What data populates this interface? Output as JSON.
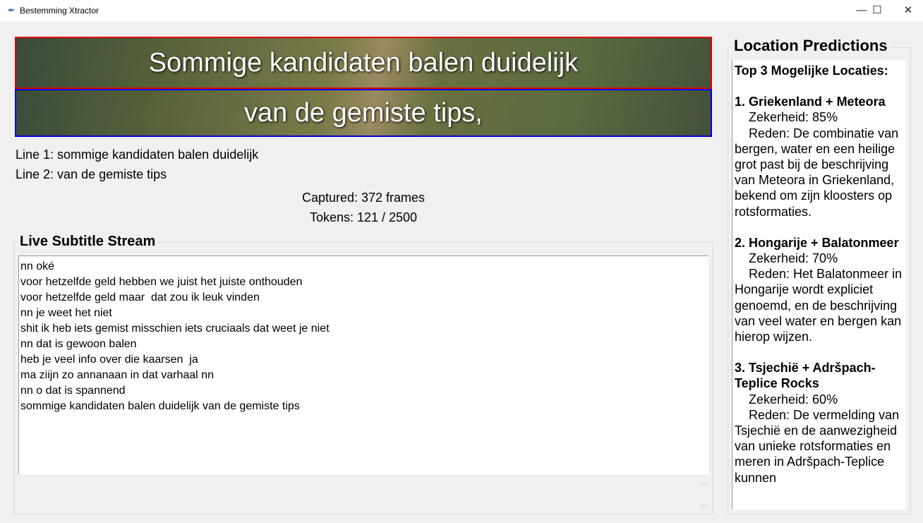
{
  "window": {
    "title": "Bestemming Xtractor",
    "minimize": "—",
    "maximize": "☐",
    "close": "✕"
  },
  "video": {
    "line1_overlay": "Sommige kandidaten balen duidelijk",
    "line2_overlay": "van de gemiste tips,"
  },
  "ocr": {
    "line1": "Line 1: sommige kandidaten balen duidelijk",
    "line2": "Line 2: van de gemiste tips"
  },
  "stats": {
    "captured": "Captured: 372 frames",
    "tokens": "Tokens: 121 / 2500"
  },
  "stream": {
    "title": "Live Subtitle Stream",
    "lines": [
      "nn oké",
      "voor hetzelfde geld hebben we juist het juiste onthouden",
      "voor hetzelfde geld maar  dat zou ik leuk vinden",
      "nn je weet het niet",
      "shit ik heb iets gemist misschien iets cruciaals dat weet je niet",
      "nn dat is gewoon balen",
      "heb je veel info over die kaarsen  ja",
      "ma ziijn zo annanaan in dat varhaal nn",
      "nn o dat is spannend",
      "sommige kandidaten balen duidelijk van de gemiste tips"
    ]
  },
  "predictions": {
    "title": "Location Predictions",
    "heading": "Top 3 Mogelijke Locaties:",
    "items": [
      {
        "name": "1. Griekenland + Meteora",
        "certainty": "Zekerheid: 85%",
        "reason": "Reden: De combinatie van bergen, water en een heilige grot past bij de beschrijving van Meteora in Griekenland, bekend om zijn kloosters op rotsformaties."
      },
      {
        "name": "2. Hongarije + Balatonmeer",
        "certainty": "Zekerheid: 70%",
        "reason": "Reden: Het Balatonmeer in Hongarije wordt expliciet genoemd, en de beschrijving van veel water en bergen kan hierop wijzen."
      },
      {
        "name": "3. Tsjechië + Adršpach-Teplice Rocks",
        "certainty": "Zekerheid: 60%",
        "reason": "Reden: De vermelding van Tsjechië en de aanwezigheid van unieke rotsformaties en meren in Adršpach-Teplice kunnen"
      }
    ]
  }
}
